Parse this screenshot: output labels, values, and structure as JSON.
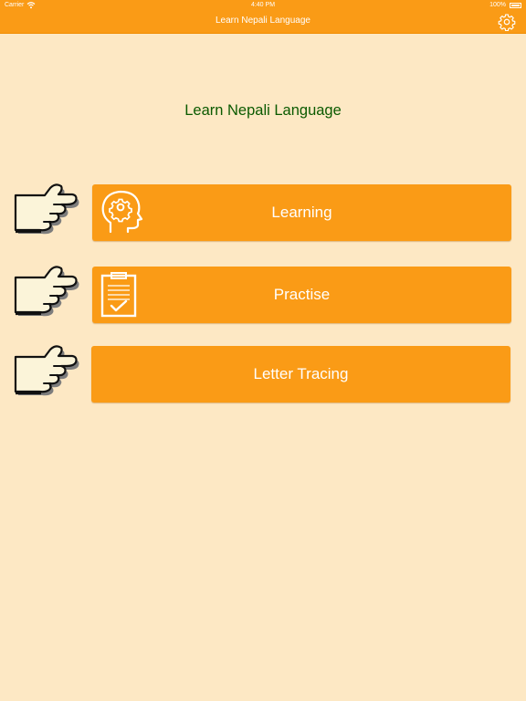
{
  "status_bar": {
    "carrier": "Carrier",
    "time": "4:40 PM",
    "battery": "100%"
  },
  "nav": {
    "title": "Learn Nepali Language",
    "settings_icon": "gear-icon"
  },
  "headline": "Learn Nepali Language",
  "menu": [
    {
      "label": "Learning",
      "icon": "head-gear-icon"
    },
    {
      "label": "Practise",
      "icon": "clipboard-check-icon"
    },
    {
      "label": "Letter Tracing",
      "icon": ""
    }
  ],
  "colors": {
    "background": "#fde8c4",
    "accent": "#fa9b16",
    "headline_text": "#0b5a00",
    "button_text": "#ffffff"
  }
}
